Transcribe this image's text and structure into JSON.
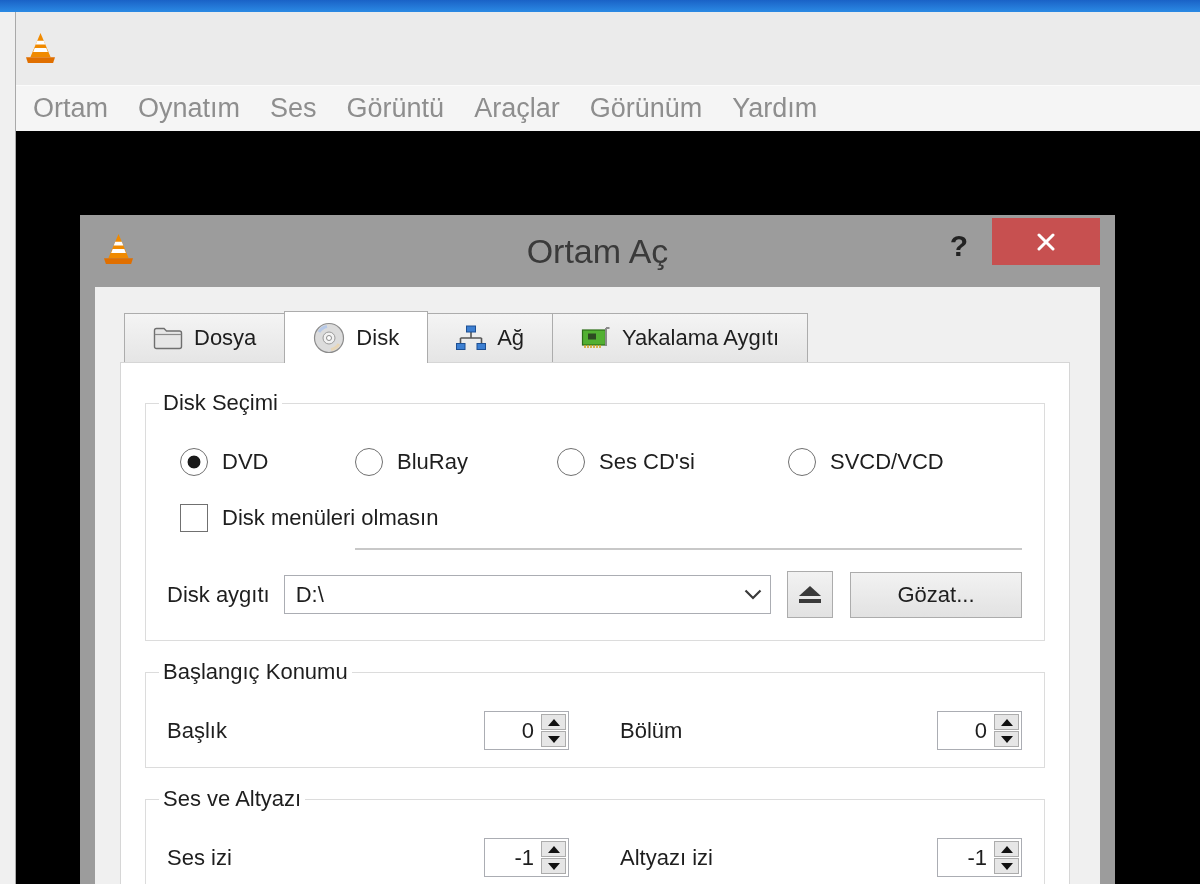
{
  "main_window": {
    "menu": [
      "Ortam",
      "Oynatım",
      "Ses",
      "Görüntü",
      "Araçlar",
      "Görünüm",
      "Yardım"
    ]
  },
  "dialog": {
    "title": "Ortam Aç",
    "help_button": "?",
    "tabs": [
      {
        "label": "Dosya",
        "selected": false
      },
      {
        "label": "Disk",
        "selected": true
      },
      {
        "label": "Ağ",
        "selected": false
      },
      {
        "label": "Yakalama Aygıtı",
        "selected": false
      }
    ],
    "disk_selection": {
      "title": "Disk Seçimi",
      "options": [
        {
          "label": "DVD",
          "selected": true
        },
        {
          "label": "BluRay",
          "selected": false
        },
        {
          "label": "Ses CD'si",
          "selected": false
        },
        {
          "label": "SVCD/VCD",
          "selected": false
        }
      ],
      "no_disc_menus": {
        "label": "Disk menüleri olmasın",
        "checked": false
      },
      "device": {
        "label": "Disk aygıtı",
        "value": "D:\\"
      },
      "browse_button": "Gözat..."
    },
    "start_position": {
      "title": "Başlangıç Konumu",
      "fields": [
        {
          "label": "Başlık",
          "value": "0"
        },
        {
          "label": "Bölüm",
          "value": "0"
        }
      ]
    },
    "audio_and_subtitles": {
      "title": "Ses ve Altyazı",
      "fields": [
        {
          "label": "Ses izi",
          "value": "-1"
        },
        {
          "label": "Altyazı izi",
          "value": "-1"
        }
      ]
    }
  }
}
